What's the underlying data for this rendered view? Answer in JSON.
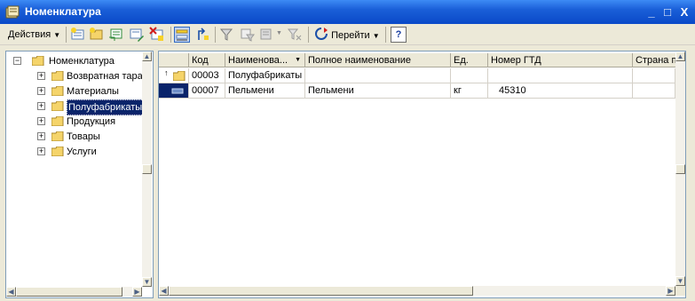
{
  "window": {
    "title": "Номенклатура",
    "buttons": {
      "minimize": "_",
      "maximize": "□",
      "close": "X"
    }
  },
  "toolbar": {
    "actions_label": "Действия",
    "goto_label": "Перейти",
    "help_label": "?"
  },
  "tree": {
    "root": "Номенклатура",
    "items": [
      {
        "label": "Возвратная тара",
        "selected": false
      },
      {
        "label": "Материалы",
        "selected": false
      },
      {
        "label": "Полуфабрикаты",
        "selected": true
      },
      {
        "label": "Продукция",
        "selected": false
      },
      {
        "label": "Товары",
        "selected": false
      },
      {
        "label": "Услуги",
        "selected": false
      }
    ]
  },
  "table": {
    "columns": [
      "Код",
      "Наименова...",
      "Полное наименование",
      "Ед.",
      "Номер ГТД",
      "Страна п"
    ],
    "sort_marker": "▼",
    "rows": [
      {
        "type": "group-up",
        "code": "00003",
        "name": "Полуфабрикаты",
        "full_name": "",
        "unit": "",
        "gtd": "",
        "country": ""
      },
      {
        "type": "item",
        "code": "00007",
        "name": "Пельмени",
        "full_name": "Пельмени",
        "unit": "кг",
        "gtd": "45310",
        "country": ""
      }
    ]
  },
  "colors": {
    "titlebar": "#0a49c8",
    "selection": "#0a246a",
    "folder": "#f5d46a"
  }
}
